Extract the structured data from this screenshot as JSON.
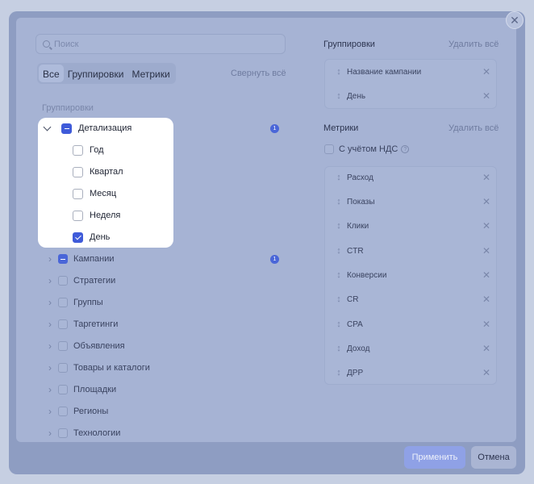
{
  "search": {
    "placeholder": "Поиск"
  },
  "tabs": [
    {
      "label": "Все"
    },
    {
      "label": "Группировки"
    },
    {
      "label": "Метрики"
    }
  ],
  "collapse_all": "Свернуть всё",
  "groupings_section_label": "Группировки",
  "tree": {
    "detail": {
      "label": "Детализация",
      "badge": "1",
      "children": [
        {
          "label": "Год",
          "checked": false
        },
        {
          "label": "Квартал",
          "checked": false
        },
        {
          "label": "Месяц",
          "checked": false
        },
        {
          "label": "Неделя",
          "checked": false
        },
        {
          "label": "День",
          "checked": true
        }
      ]
    },
    "items": [
      {
        "label": "Кампании",
        "badge": "1"
      },
      {
        "label": "Стратегии"
      },
      {
        "label": "Группы"
      },
      {
        "label": "Таргетинги"
      },
      {
        "label": "Объявления"
      },
      {
        "label": "Товары и каталоги"
      },
      {
        "label": "Площадки"
      },
      {
        "label": "Регионы"
      },
      {
        "label": "Технологии"
      }
    ]
  },
  "right": {
    "groupings_title": "Группировки",
    "groupings_clear": "Удалить всё",
    "groupings": [
      {
        "label": "Название кампании"
      },
      {
        "label": "День"
      }
    ],
    "metrics_title": "Метрики",
    "metrics_clear": "Удалить всё",
    "vat_label": "С учётом НДС",
    "metrics": [
      {
        "label": "Расход"
      },
      {
        "label": "Показы"
      },
      {
        "label": "Клики"
      },
      {
        "label": "CTR"
      },
      {
        "label": "Конверсии"
      },
      {
        "label": "CR"
      },
      {
        "label": "CPA"
      },
      {
        "label": "Доход"
      },
      {
        "label": "ДРР"
      }
    ]
  },
  "footer": {
    "apply": "Применить",
    "cancel": "Отмена"
  },
  "icons": {
    "close": "close-icon",
    "search": "search-icon",
    "drag": "drag-handle-icon",
    "remove": "remove-icon",
    "info": "info-icon"
  }
}
